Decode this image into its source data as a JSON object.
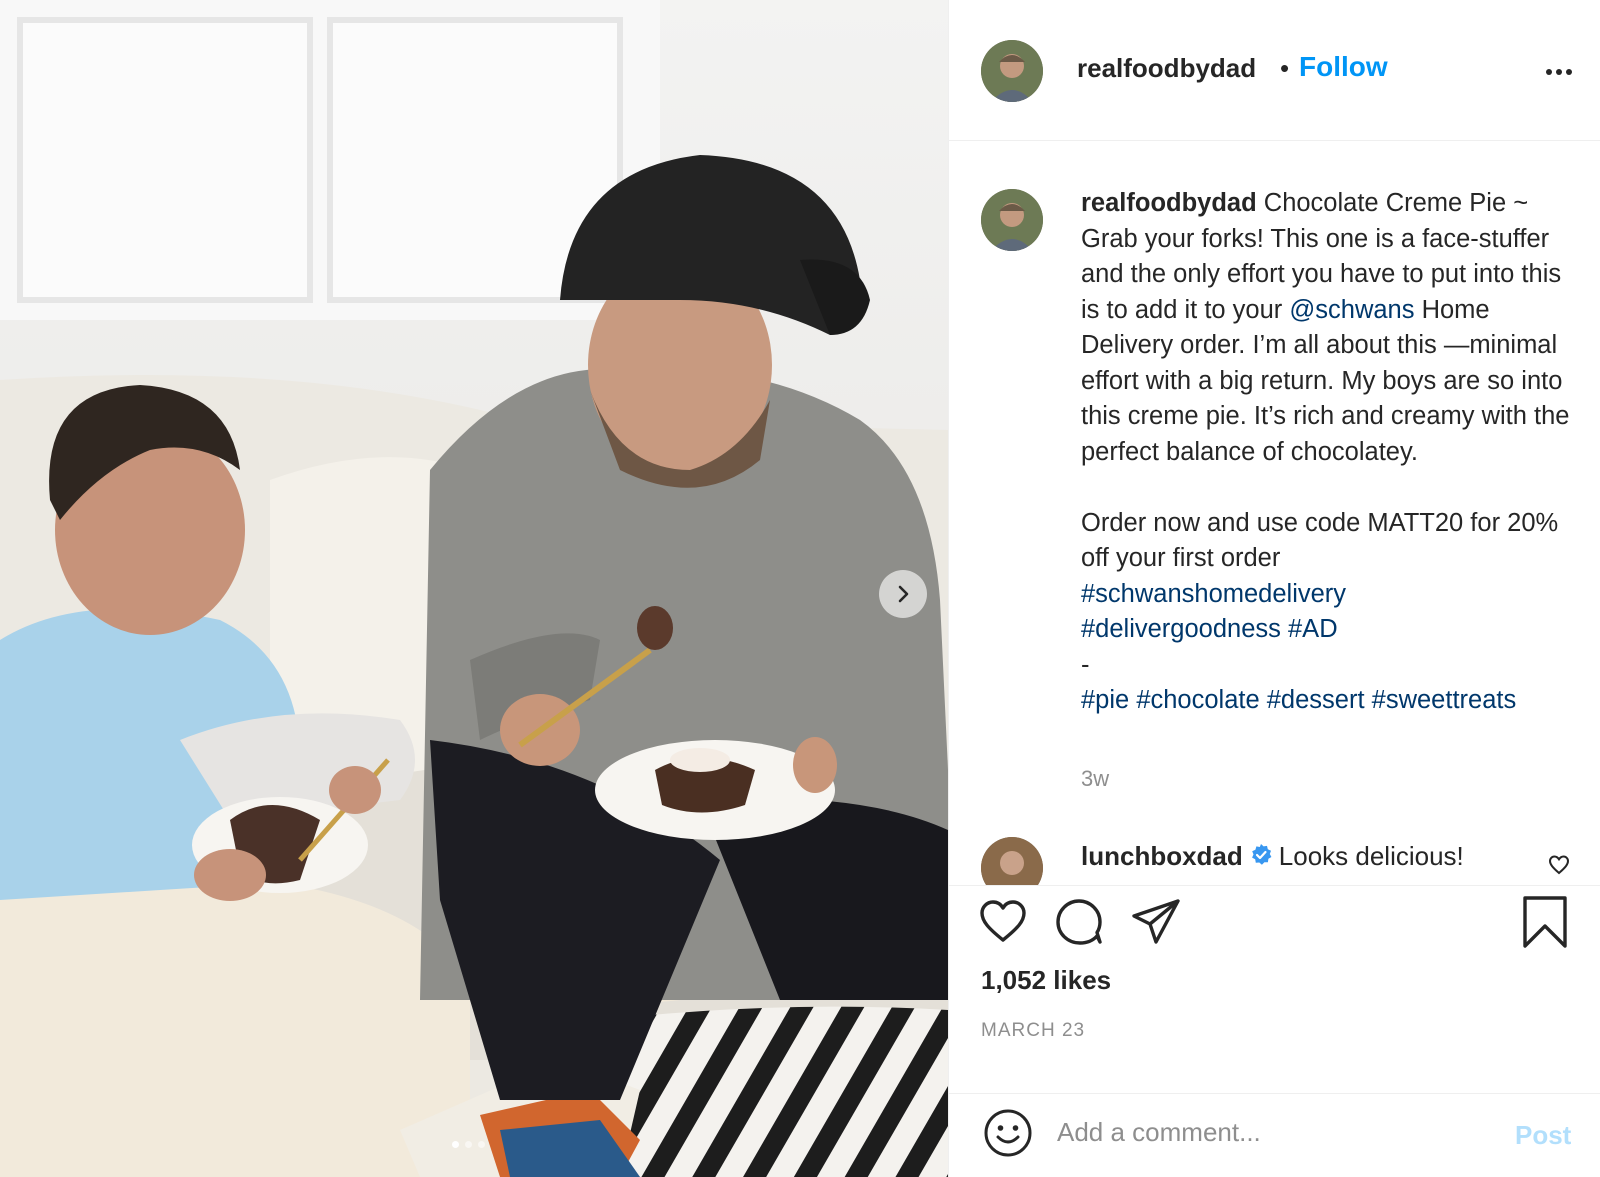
{
  "post": {
    "username": "realfoodbydad",
    "follow_label": "Follow",
    "header_separator": "•",
    "caption": {
      "username": "realfoodbydad",
      "text_1": "Chocolate Creme Pie ~ Grab your forks! This one is a face-stuffer and the only effort you have to put into this is to add it to your",
      "mention": "@schwans",
      "text_2": "Home Delivery order. I’m all about this —minimal effort with a big return. My boys are so into this creme pie. It’s rich and creamy with the perfect balance of chocolatey.",
      "text_3": "Order now and use code MATT20 for 20% off your first order",
      "hashtag_1": "#schwanshomedelivery",
      "hashtag_2": "#delivergoodness",
      "hashtag_3": "#AD",
      "dash": "-",
      "hashtag_4": "#pie",
      "hashtag_5": "#chocolate",
      "hashtag_6": "#dessert",
      "hashtag_7": "#sweettreats",
      "time": "3w"
    },
    "comments": [
      {
        "username": "lunchboxdad",
        "verified": true,
        "text": "Looks delicious!"
      }
    ],
    "likes": "1,052 likes",
    "date": "MARCH 23",
    "comment_placeholder": "Add a comment...",
    "post_button": "Post",
    "carousel": {
      "total": 3,
      "active": 0
    }
  },
  "colors": {
    "link_blue": "#0095f6",
    "hashtag_navy": "#00376b",
    "muted_gray": "#8e8e8e",
    "post_disabled": "#b2dffc",
    "verified_badge": "#3897f0"
  },
  "icons": [
    "more-icon",
    "chevron-right-icon",
    "heart-icon",
    "comment-icon",
    "share-icon",
    "bookmark-icon",
    "emoji-icon",
    "verified-icon"
  ]
}
